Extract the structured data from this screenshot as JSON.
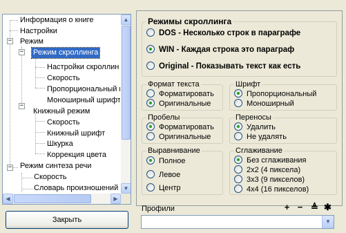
{
  "tree": {
    "items": [
      {
        "label": "Информация о книге"
      },
      {
        "label": "Настройки"
      },
      {
        "label": "Режим"
      },
      {
        "label": "Режим скроллинга"
      },
      {
        "label": "Настройки скроллин"
      },
      {
        "label": "Скорость"
      },
      {
        "label": "Пропорциональный ш"
      },
      {
        "label": "Моноширный шрифт"
      },
      {
        "label": "Книжный режим"
      },
      {
        "label": "Скорость"
      },
      {
        "label": "Книжный шрифт"
      },
      {
        "label": "Шкурка"
      },
      {
        "label": "Коррекция цвета"
      },
      {
        "label": "Режим синтеза речи"
      },
      {
        "label": "Скорость"
      },
      {
        "label": "Словарь произношений"
      }
    ],
    "selected_index": 3
  },
  "close_button": "Закрыть",
  "scroll_modes": {
    "title": "Режимы скроллинга",
    "options": [
      {
        "label": "DOS - Несколько строк в параграфе",
        "selected": false
      },
      {
        "label": "WIN - Каждая строка это параграф",
        "selected": true
      },
      {
        "label": "Original - Показывать текст как есть",
        "selected": false
      }
    ]
  },
  "text_format": {
    "title": "Формат текста",
    "options": [
      {
        "label": "Форматировать",
        "selected": false
      },
      {
        "label": "Оригинальные",
        "selected": true
      }
    ]
  },
  "font": {
    "title": "Шрифт",
    "options": [
      {
        "label": "Пропорциональный",
        "selected": true
      },
      {
        "label": "Моноширный",
        "selected": false
      }
    ]
  },
  "spaces": {
    "title": "Пробелы",
    "options": [
      {
        "label": "Форматировать",
        "selected": true
      },
      {
        "label": "Оригинальные",
        "selected": false
      }
    ]
  },
  "hyphenation": {
    "title": "Переносы",
    "options": [
      {
        "label": "Удалить",
        "selected": true
      },
      {
        "label": "Не удалять",
        "selected": false
      }
    ]
  },
  "alignment": {
    "title": "Выравнивание",
    "options": [
      {
        "label": "Полное",
        "selected": true
      },
      {
        "label": "Левое",
        "selected": false
      },
      {
        "label": "Центр",
        "selected": false
      }
    ]
  },
  "smoothing": {
    "title": "Сглаживание",
    "options": [
      {
        "label": "Без сглаживания",
        "selected": true
      },
      {
        "label": "2x2 (4 пиксела)",
        "selected": false
      },
      {
        "label": "3x3 (9 пикселов)",
        "selected": false
      },
      {
        "label": "4x4 (16 пикселов)",
        "selected": false
      }
    ]
  },
  "profiles": {
    "label": "Профили",
    "value": "",
    "buttons": [
      {
        "name": "add-profile-button",
        "glyph": "+"
      },
      {
        "name": "remove-profile-button",
        "glyph": "−"
      },
      {
        "name": "save-profile-button",
        "glyph": "≜"
      },
      {
        "name": "profile-settings-button",
        "glyph": "✱"
      }
    ]
  }
}
